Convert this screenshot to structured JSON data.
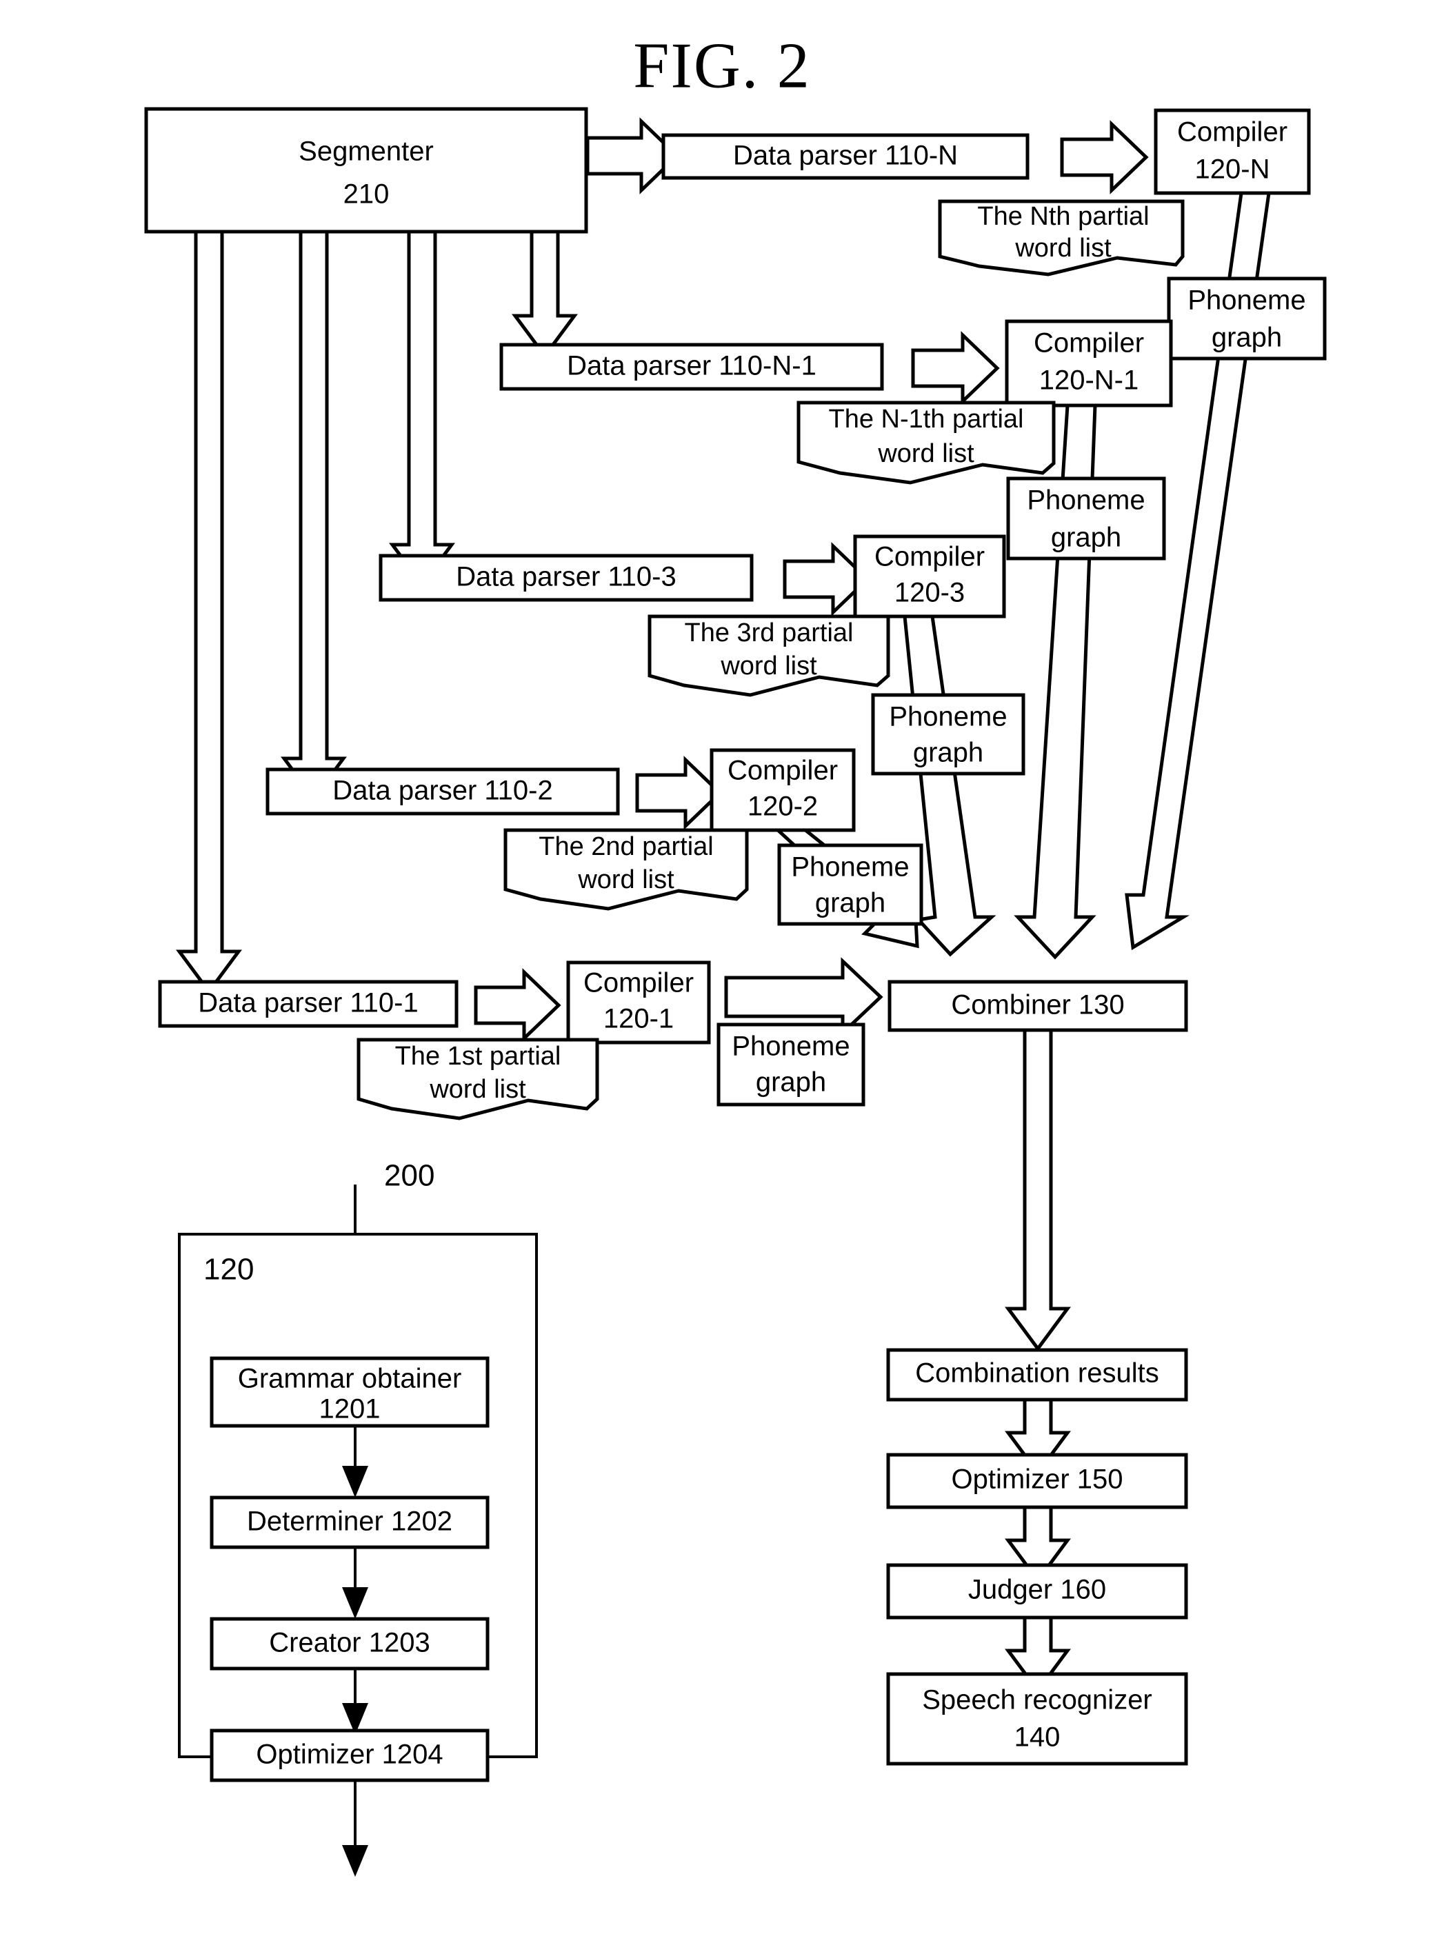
{
  "figure": {
    "title": "FIG. 2",
    "ref_200": "200",
    "ref_120": "120"
  },
  "segmenter": {
    "line1": "Segmenter",
    "line2": "210"
  },
  "pipeline_rows": [
    {
      "parser": "Data parser 110-N",
      "compiler_line1": "Compiler",
      "compiler_line2": "120-N",
      "word_list_line1": "The Nth partial",
      "word_list_line2": "word list",
      "phoneme_line1": "Phoneme",
      "phoneme_line2": "graph"
    },
    {
      "parser": "Data parser 110-N-1",
      "compiler_line1": "Compiler",
      "compiler_line2": "120-N-1",
      "word_list_line1": "The N-1th partial",
      "word_list_line2": "word list",
      "phoneme_line1": "Phoneme",
      "phoneme_line2": "graph"
    },
    {
      "parser": "Data parser 110-3",
      "compiler_line1": "Compiler",
      "compiler_line2": "120-3",
      "word_list_line1": "The 3rd partial",
      "word_list_line2": "word list",
      "phoneme_line1": "Phoneme",
      "phoneme_line2": "graph"
    },
    {
      "parser": "Data parser 110-2",
      "compiler_line1": "Compiler",
      "compiler_line2": "120-2",
      "word_list_line1": "The 2nd partial",
      "word_list_line2": "word list",
      "phoneme_line1": "Phoneme",
      "phoneme_line2": "graph"
    },
    {
      "parser": "Data parser 110-1",
      "compiler_line1": "Compiler",
      "compiler_line2": "120-1",
      "word_list_line1": "The 1st partial",
      "word_list_line2": "word list",
      "phoneme_line1": "Phoneme",
      "phoneme_line2": "graph"
    }
  ],
  "right_chain": {
    "combiner": "Combiner 130",
    "combination_results": "Combination results",
    "optimizer": "Optimizer 150",
    "judger": "Judger 160",
    "speech_recognizer_line1": "Speech recognizer",
    "speech_recognizer_line2": "140"
  },
  "compiler_detail": {
    "grammar_obtainer_line1": "Grammar obtainer",
    "grammar_obtainer_line2": "1201",
    "determiner": "Determiner 1202",
    "creator": "Creator 1203",
    "optimizer": "Optimizer 1204"
  },
  "colors": {
    "ink": "#000000",
    "paper": "#ffffff"
  }
}
